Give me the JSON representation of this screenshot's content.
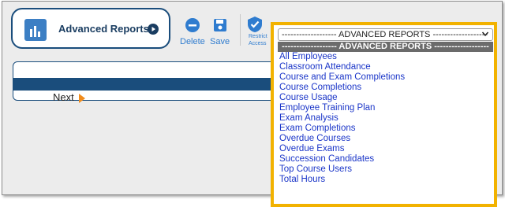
{
  "report_button": {
    "title": "Advanced Reports"
  },
  "toolbar": {
    "delete_label": "Delete",
    "save_label": "Save",
    "restrict_label_line1": "Restrict",
    "restrict_label_line2": "Access"
  },
  "nav": {
    "next_label": "Next"
  },
  "dropdown": {
    "selected": "------------------- ADVANCED REPORTS -------------------",
    "header": "------------------- ADVANCED REPORTS -------------------",
    "options": [
      "All Employees",
      "Classroom Attendance",
      "Course and Exam Completions",
      "Course Completions",
      "Course Usage",
      "Employee Training Plan",
      "Exam Analysis",
      "Exam Completions",
      "Overdue Courses",
      "Overdue Exams",
      "Succession Candidates",
      "Top Course Users",
      "Total Hours"
    ]
  },
  "colors": {
    "accent": "#2f7ccf",
    "navy": "#1a4d7c",
    "highlight": "#f2b200",
    "link": "#1a35c8"
  }
}
